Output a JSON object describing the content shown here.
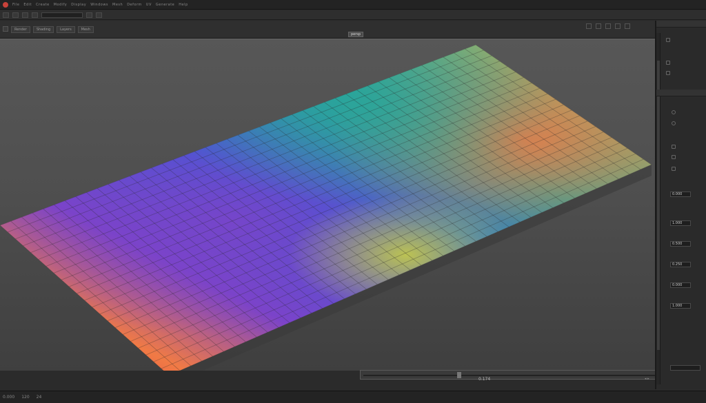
{
  "menubar": {
    "items": [
      "File",
      "Edit",
      "Create",
      "Modify",
      "Display",
      "Windows",
      "Mesh",
      "Deform",
      "UV",
      "Generate",
      "Help"
    ]
  },
  "tabs": [
    "Render",
    "Shading",
    "Layers",
    "Mesh"
  ],
  "viewport": {
    "label": "persp"
  },
  "timeline": {
    "value": "0.174"
  },
  "panel": {
    "fields": [
      "0.000",
      "1.000",
      "0.500",
      "0.250",
      "0.000",
      "1.000"
    ]
  },
  "status": {
    "items": [
      "0.000",
      "120",
      "24"
    ]
  },
  "colors": {
    "accent": "#c8423a",
    "surface_palette": [
      "#e03a43",
      "#f07a45",
      "#e0b84a",
      "#c2c84c",
      "#3ea88a",
      "#2aa59a",
      "#2f7fc8",
      "#3d5bd6",
      "#7b43c9",
      "#b04ab8"
    ]
  },
  "icons": [
    "app-logo-icon",
    "move-tool-icon",
    "rotate-tool-icon",
    "scale-tool-icon",
    "camera-icon"
  ]
}
